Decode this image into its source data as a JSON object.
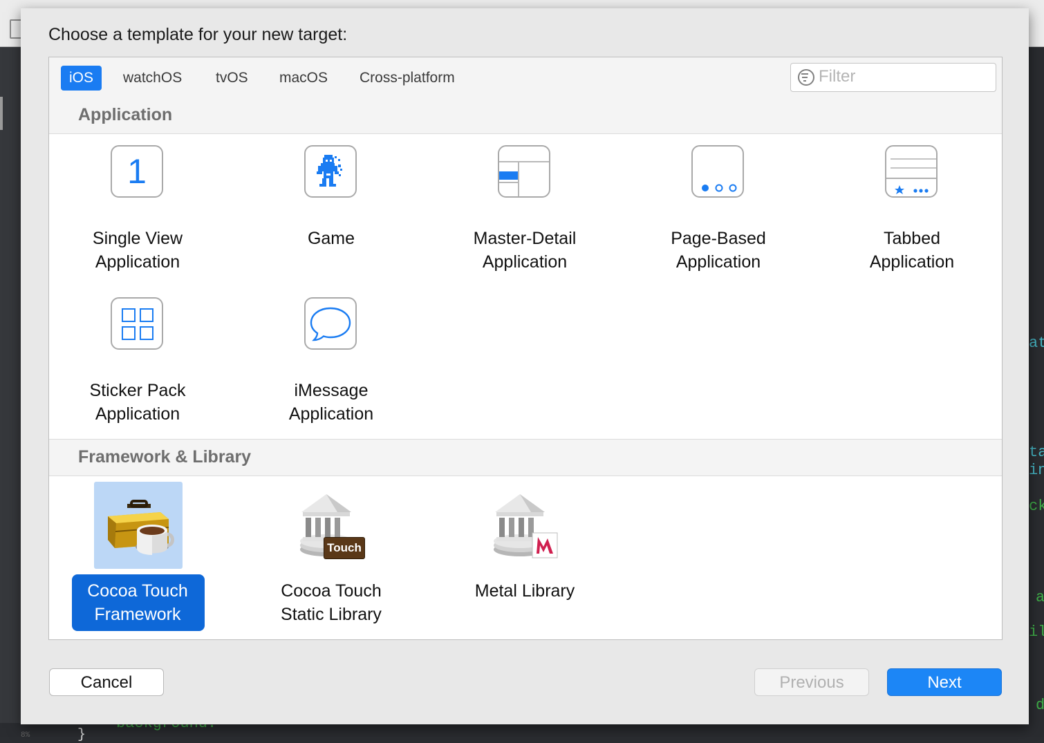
{
  "dialog": {
    "title": "Choose a template for your new target:"
  },
  "platform_tabs": [
    {
      "label": "iOS",
      "selected": true
    },
    {
      "label": "watchOS",
      "selected": false
    },
    {
      "label": "tvOS",
      "selected": false
    },
    {
      "label": "macOS",
      "selected": false
    },
    {
      "label": "Cross-platform",
      "selected": false
    }
  ],
  "filter": {
    "placeholder": "Filter",
    "value": ""
  },
  "sections": [
    {
      "title": "Application",
      "templates": [
        {
          "label": "Single View Application",
          "label_lines": [
            "Single View",
            "Application"
          ],
          "icon": "single-view-icon"
        },
        {
          "label": "Game",
          "label_lines": [
            "Game"
          ],
          "icon": "game-icon"
        },
        {
          "label": "Master-Detail Application",
          "label_lines": [
            "Master-Detail",
            "Application"
          ],
          "icon": "master-detail-icon"
        },
        {
          "label": "Page-Based Application",
          "label_lines": [
            "Page-Based",
            "Application"
          ],
          "icon": "page-based-icon"
        },
        {
          "label": "Tabbed Application",
          "label_lines": [
            "Tabbed",
            "Application"
          ],
          "icon": "tabbed-icon"
        },
        {
          "label": "Sticker Pack Application",
          "label_lines": [
            "Sticker Pack",
            "Application"
          ],
          "icon": "sticker-pack-icon"
        },
        {
          "label": "iMessage Application",
          "label_lines": [
            "iMessage",
            "Application"
          ],
          "icon": "imessage-icon"
        }
      ]
    },
    {
      "title": "Framework & Library",
      "templates": [
        {
          "label": "Cocoa Touch Framework",
          "label_lines": [
            "Cocoa Touch",
            "Framework"
          ],
          "icon": "cocoa-touch-framework-icon",
          "selected": true
        },
        {
          "label": "Cocoa Touch Static Library",
          "label_lines": [
            "Cocoa Touch",
            "Static Library"
          ],
          "icon": "cocoa-touch-static-library-icon",
          "badge": "Touch"
        },
        {
          "label": "Metal Library",
          "label_lines": [
            "Metal Library"
          ],
          "icon": "metal-library-icon"
        }
      ]
    }
  ],
  "icon_text": {
    "single_view_number": "1"
  },
  "buttons": {
    "cancel": "Cancel",
    "previous": "Previous",
    "next": "Next"
  },
  "background_code": {
    "bottom_line": "background:",
    "brace": "}",
    "line_number": "8%",
    "right_fragments": [
      "at",
      "ta",
      "in",
      "ck",
      "a",
      "il",
      "d"
    ]
  },
  "colors": {
    "accent": "#1a7cf2",
    "selection": "#0e68d8",
    "selection_light": "#bcd7f6",
    "section_header_text": "#6e6e6e"
  }
}
